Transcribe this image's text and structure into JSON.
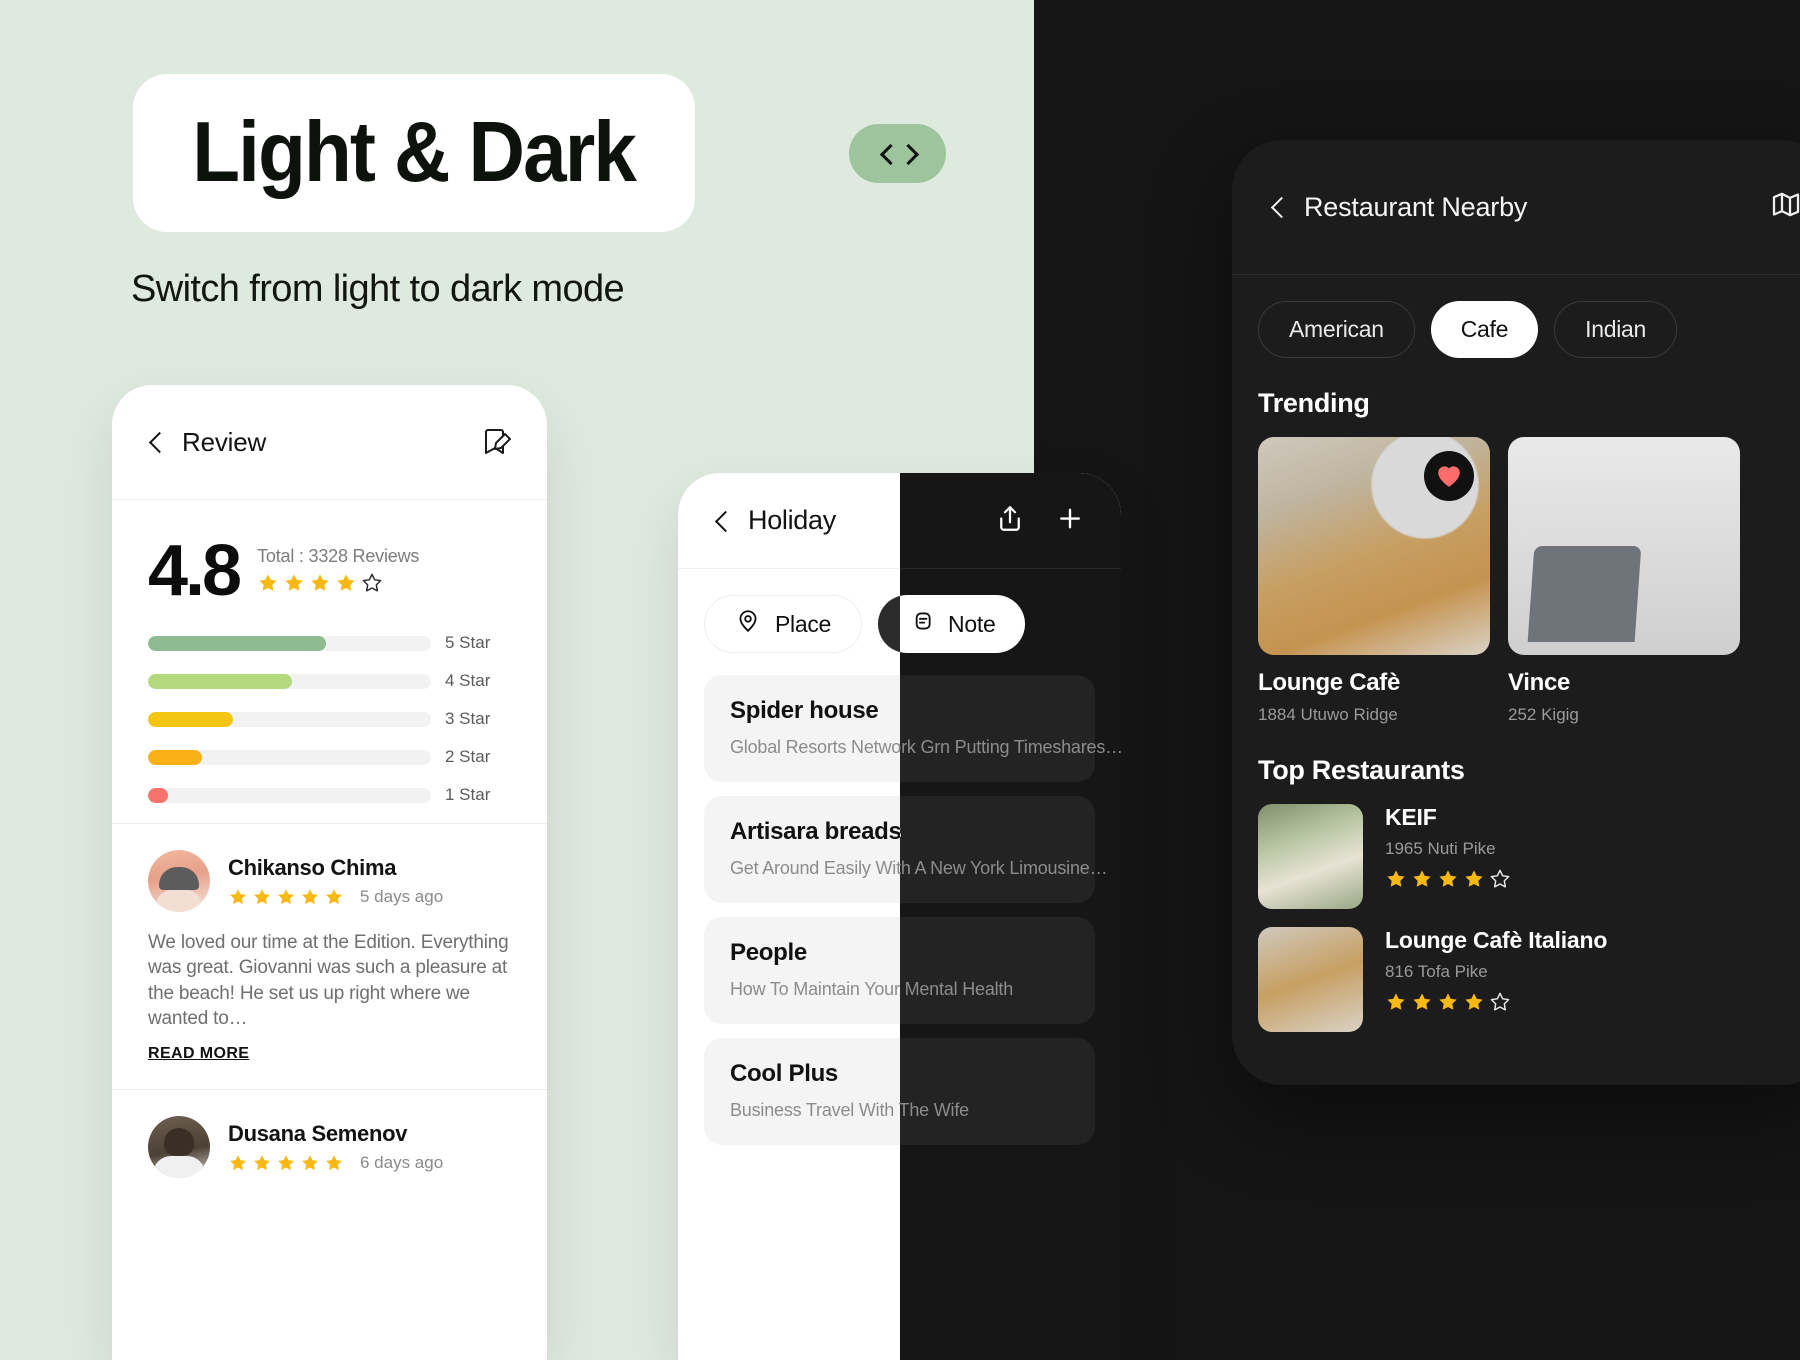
{
  "hero": {
    "title": "Light & Dark",
    "subtitle": "Switch from light to dark mode",
    "prev_icon": "chevron-left-icon",
    "next_icon": "chevron-right-icon"
  },
  "review_screen": {
    "back_icon": "chevron-left-icon",
    "title": "Review",
    "edit_icon": "edit-note-icon",
    "score": "4.8",
    "total_label": "Total : 3328 Reviews",
    "score_stars_filled": 4,
    "score_stars_total": 5,
    "bars": [
      {
        "label": "5 Star",
        "percent": 63,
        "color": "#8fbb92"
      },
      {
        "label": "4 Star",
        "percent": 51,
        "color": "#b3d97f"
      },
      {
        "label": "3 Star",
        "percent": 30,
        "color": "#f5c513"
      },
      {
        "label": "2 Star",
        "percent": 19,
        "color": "#f9b115"
      },
      {
        "label": "1 Star",
        "percent": 7,
        "color": "#f8726e"
      }
    ],
    "reviews": [
      {
        "name": "Chikanso Chima",
        "stars": 5,
        "ago": "5 days ago",
        "text": "We loved our time at the Edition. Everything was great. Giovanni was such a pleasure at the beach! He set us up right where we wanted to…",
        "read_more": "READ MORE"
      },
      {
        "name": "Dusana Semenov",
        "stars": 5,
        "ago": "6 days ago",
        "text": "",
        "read_more": ""
      }
    ]
  },
  "holiday_screen": {
    "back_icon": "chevron-left-icon",
    "title": "Holiday",
    "share_icon": "share-icon",
    "add_icon": "plus-icon",
    "tabs": [
      {
        "label": "Place",
        "icon": "location-pin-icon",
        "active": false
      },
      {
        "label": "Note",
        "icon": "notes-icon",
        "active": true
      }
    ],
    "notes": [
      {
        "title": "Spider house",
        "desc": "Global Resorts Network Grn Putting Timeshares…"
      },
      {
        "title": "Artisara breads",
        "desc": "Get Around Easily With A New York Limousine…"
      },
      {
        "title": "People",
        "desc": "How To Maintain Your Mental Health"
      },
      {
        "title": "Cool Plus",
        "desc": "Business Travel With The Wife"
      }
    ]
  },
  "restaurant_screen": {
    "back_icon": "chevron-left-icon",
    "title": "Restaurant Nearby",
    "map_icon": "map-icon",
    "chips": [
      {
        "label": "American",
        "active": false
      },
      {
        "label": "Cafe",
        "active": true
      },
      {
        "label": "Indian",
        "active": false
      }
    ],
    "trending_title": "Trending",
    "trending": [
      {
        "name": "Lounge Cafè",
        "address": "1884 Utuwo Ridge",
        "favorite": true,
        "favorite_icon": "heart-icon"
      },
      {
        "name": "Vince",
        "address": "252 Kigig",
        "favorite": false,
        "favorite_icon": "heart-icon"
      }
    ],
    "top_title": "Top Restaurants",
    "top_restaurants": [
      {
        "name": "KEIF",
        "address": "1965 Nuti Pike",
        "stars_filled": 4,
        "stars_total": 5
      },
      {
        "name": "Lounge Cafè Italiano",
        "address": "816 Tofa Pike",
        "stars_filled": 4,
        "stars_total": 5
      }
    ]
  },
  "colors": {
    "light_bg": "#dfeade",
    "dark_bg": "#151515",
    "accent_green": "#9dc49d",
    "star_gold": "#f9b915",
    "heart_red": "#fb6d6a"
  }
}
